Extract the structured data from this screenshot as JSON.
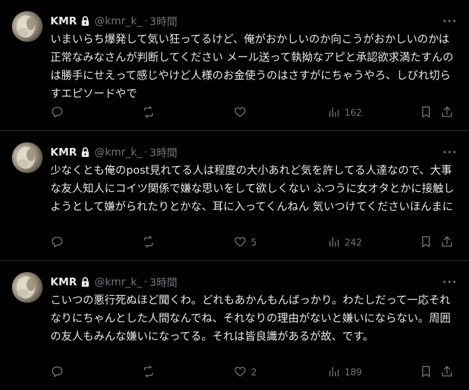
{
  "tweets": [
    {
      "name": "KMR",
      "handle": "@kmr_k_",
      "separator": "·",
      "time": "3時間",
      "text": "いまいらち爆発して気い狂ってるけど、俺がおかしいのか向こうがおかしいのかは正常なみなさんが判断してください メール送って執拗なアピと承認欲求満たすんのは勝手にせえって感じやけど人様のお金使うのはさすがにちゃうやろ、しびれ切らすエピソードやで",
      "replies": "",
      "reposts": "",
      "likes": "",
      "views": "162"
    },
    {
      "name": "KMR",
      "handle": "@kmr_k_",
      "separator": "·",
      "time": "3時間",
      "text": "少なくとも俺のpost見れてる人は程度の大小あれど気を許してる人達なので、大事な友人知人にコイツ関係で嫌な思いをして欲しくない ふつうに女オタとかに接触しようとして嫌がられたりとかな、耳に入ってくんねん 気いつけてくださいほんまに",
      "replies": "",
      "reposts": "",
      "likes": "5",
      "views": "242"
    },
    {
      "name": "KMR",
      "handle": "@kmr_k_",
      "separator": "·",
      "time": "3時間",
      "text": "こいつの悪行死ぬほど聞くわ。どれもあかんもんばっかり。わたしだって一応それなりにちゃんとした人間なんでね、それなりの理由がないと嫌いにならない。周囲の友人もみんな嫌いになってる。それは皆良識があるが故、です。",
      "replies": "",
      "reposts": "",
      "likes": "2",
      "views": "189"
    }
  ],
  "colors": {
    "background": "#000000",
    "text": "#e7e9ea",
    "secondary": "#71767b",
    "divider": "#2f3336"
  },
  "icons": [
    "lock-icon",
    "more-icon",
    "reply-icon",
    "repost-icon",
    "like-icon",
    "views-icon",
    "bookmark-icon",
    "share-icon"
  ]
}
